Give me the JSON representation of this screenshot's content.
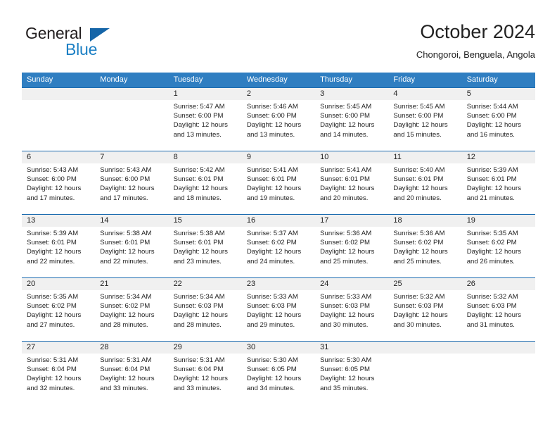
{
  "brand": {
    "name_part1": "General",
    "name_part2": "Blue",
    "triangle_color": "#1565a8",
    "blue_color": "#1b7fc4"
  },
  "header": {
    "title": "October 2024",
    "subtitle": "Chongoroi, Benguela, Angola"
  },
  "colors": {
    "header_row_bg": "#2f7ec1",
    "header_row_text": "#ffffff",
    "week_strip_bg": "#f0f0f0",
    "week_divider": "#1b6bb0",
    "text": "#222222"
  },
  "weekdays": [
    "Sunday",
    "Monday",
    "Tuesday",
    "Wednesday",
    "Thursday",
    "Friday",
    "Saturday"
  ],
  "weeks": [
    {
      "days": [
        {
          "number": "",
          "empty": true,
          "sunrise": "",
          "sunset": "",
          "daylight_line1": "",
          "daylight_line2": ""
        },
        {
          "number": "",
          "empty": true,
          "sunrise": "",
          "sunset": "",
          "daylight_line1": "",
          "daylight_line2": ""
        },
        {
          "number": "1",
          "empty": false,
          "sunrise": "Sunrise: 5:47 AM",
          "sunset": "Sunset: 6:00 PM",
          "daylight_line1": "Daylight: 12 hours",
          "daylight_line2": "and 13 minutes."
        },
        {
          "number": "2",
          "empty": false,
          "sunrise": "Sunrise: 5:46 AM",
          "sunset": "Sunset: 6:00 PM",
          "daylight_line1": "Daylight: 12 hours",
          "daylight_line2": "and 13 minutes."
        },
        {
          "number": "3",
          "empty": false,
          "sunrise": "Sunrise: 5:45 AM",
          "sunset": "Sunset: 6:00 PM",
          "daylight_line1": "Daylight: 12 hours",
          "daylight_line2": "and 14 minutes."
        },
        {
          "number": "4",
          "empty": false,
          "sunrise": "Sunrise: 5:45 AM",
          "sunset": "Sunset: 6:00 PM",
          "daylight_line1": "Daylight: 12 hours",
          "daylight_line2": "and 15 minutes."
        },
        {
          "number": "5",
          "empty": false,
          "sunrise": "Sunrise: 5:44 AM",
          "sunset": "Sunset: 6:00 PM",
          "daylight_line1": "Daylight: 12 hours",
          "daylight_line2": "and 16 minutes."
        }
      ]
    },
    {
      "days": [
        {
          "number": "6",
          "empty": false,
          "sunrise": "Sunrise: 5:43 AM",
          "sunset": "Sunset: 6:00 PM",
          "daylight_line1": "Daylight: 12 hours",
          "daylight_line2": "and 17 minutes."
        },
        {
          "number": "7",
          "empty": false,
          "sunrise": "Sunrise: 5:43 AM",
          "sunset": "Sunset: 6:00 PM",
          "daylight_line1": "Daylight: 12 hours",
          "daylight_line2": "and 17 minutes."
        },
        {
          "number": "8",
          "empty": false,
          "sunrise": "Sunrise: 5:42 AM",
          "sunset": "Sunset: 6:01 PM",
          "daylight_line1": "Daylight: 12 hours",
          "daylight_line2": "and 18 minutes."
        },
        {
          "number": "9",
          "empty": false,
          "sunrise": "Sunrise: 5:41 AM",
          "sunset": "Sunset: 6:01 PM",
          "daylight_line1": "Daylight: 12 hours",
          "daylight_line2": "and 19 minutes."
        },
        {
          "number": "10",
          "empty": false,
          "sunrise": "Sunrise: 5:41 AM",
          "sunset": "Sunset: 6:01 PM",
          "daylight_line1": "Daylight: 12 hours",
          "daylight_line2": "and 20 minutes."
        },
        {
          "number": "11",
          "empty": false,
          "sunrise": "Sunrise: 5:40 AM",
          "sunset": "Sunset: 6:01 PM",
          "daylight_line1": "Daylight: 12 hours",
          "daylight_line2": "and 20 minutes."
        },
        {
          "number": "12",
          "empty": false,
          "sunrise": "Sunrise: 5:39 AM",
          "sunset": "Sunset: 6:01 PM",
          "daylight_line1": "Daylight: 12 hours",
          "daylight_line2": "and 21 minutes."
        }
      ]
    },
    {
      "days": [
        {
          "number": "13",
          "empty": false,
          "sunrise": "Sunrise: 5:39 AM",
          "sunset": "Sunset: 6:01 PM",
          "daylight_line1": "Daylight: 12 hours",
          "daylight_line2": "and 22 minutes."
        },
        {
          "number": "14",
          "empty": false,
          "sunrise": "Sunrise: 5:38 AM",
          "sunset": "Sunset: 6:01 PM",
          "daylight_line1": "Daylight: 12 hours",
          "daylight_line2": "and 22 minutes."
        },
        {
          "number": "15",
          "empty": false,
          "sunrise": "Sunrise: 5:38 AM",
          "sunset": "Sunset: 6:01 PM",
          "daylight_line1": "Daylight: 12 hours",
          "daylight_line2": "and 23 minutes."
        },
        {
          "number": "16",
          "empty": false,
          "sunrise": "Sunrise: 5:37 AM",
          "sunset": "Sunset: 6:02 PM",
          "daylight_line1": "Daylight: 12 hours",
          "daylight_line2": "and 24 minutes."
        },
        {
          "number": "17",
          "empty": false,
          "sunrise": "Sunrise: 5:36 AM",
          "sunset": "Sunset: 6:02 PM",
          "daylight_line1": "Daylight: 12 hours",
          "daylight_line2": "and 25 minutes."
        },
        {
          "number": "18",
          "empty": false,
          "sunrise": "Sunrise: 5:36 AM",
          "sunset": "Sunset: 6:02 PM",
          "daylight_line1": "Daylight: 12 hours",
          "daylight_line2": "and 25 minutes."
        },
        {
          "number": "19",
          "empty": false,
          "sunrise": "Sunrise: 5:35 AM",
          "sunset": "Sunset: 6:02 PM",
          "daylight_line1": "Daylight: 12 hours",
          "daylight_line2": "and 26 minutes."
        }
      ]
    },
    {
      "days": [
        {
          "number": "20",
          "empty": false,
          "sunrise": "Sunrise: 5:35 AM",
          "sunset": "Sunset: 6:02 PM",
          "daylight_line1": "Daylight: 12 hours",
          "daylight_line2": "and 27 minutes."
        },
        {
          "number": "21",
          "empty": false,
          "sunrise": "Sunrise: 5:34 AM",
          "sunset": "Sunset: 6:02 PM",
          "daylight_line1": "Daylight: 12 hours",
          "daylight_line2": "and 28 minutes."
        },
        {
          "number": "22",
          "empty": false,
          "sunrise": "Sunrise: 5:34 AM",
          "sunset": "Sunset: 6:03 PM",
          "daylight_line1": "Daylight: 12 hours",
          "daylight_line2": "and 28 minutes."
        },
        {
          "number": "23",
          "empty": false,
          "sunrise": "Sunrise: 5:33 AM",
          "sunset": "Sunset: 6:03 PM",
          "daylight_line1": "Daylight: 12 hours",
          "daylight_line2": "and 29 minutes."
        },
        {
          "number": "24",
          "empty": false,
          "sunrise": "Sunrise: 5:33 AM",
          "sunset": "Sunset: 6:03 PM",
          "daylight_line1": "Daylight: 12 hours",
          "daylight_line2": "and 30 minutes."
        },
        {
          "number": "25",
          "empty": false,
          "sunrise": "Sunrise: 5:32 AM",
          "sunset": "Sunset: 6:03 PM",
          "daylight_line1": "Daylight: 12 hours",
          "daylight_line2": "and 30 minutes."
        },
        {
          "number": "26",
          "empty": false,
          "sunrise": "Sunrise: 5:32 AM",
          "sunset": "Sunset: 6:03 PM",
          "daylight_line1": "Daylight: 12 hours",
          "daylight_line2": "and 31 minutes."
        }
      ]
    },
    {
      "days": [
        {
          "number": "27",
          "empty": false,
          "sunrise": "Sunrise: 5:31 AM",
          "sunset": "Sunset: 6:04 PM",
          "daylight_line1": "Daylight: 12 hours",
          "daylight_line2": "and 32 minutes."
        },
        {
          "number": "28",
          "empty": false,
          "sunrise": "Sunrise: 5:31 AM",
          "sunset": "Sunset: 6:04 PM",
          "daylight_line1": "Daylight: 12 hours",
          "daylight_line2": "and 33 minutes."
        },
        {
          "number": "29",
          "empty": false,
          "sunrise": "Sunrise: 5:31 AM",
          "sunset": "Sunset: 6:04 PM",
          "daylight_line1": "Daylight: 12 hours",
          "daylight_line2": "and 33 minutes."
        },
        {
          "number": "30",
          "empty": false,
          "sunrise": "Sunrise: 5:30 AM",
          "sunset": "Sunset: 6:05 PM",
          "daylight_line1": "Daylight: 12 hours",
          "daylight_line2": "and 34 minutes."
        },
        {
          "number": "31",
          "empty": false,
          "sunrise": "Sunrise: 5:30 AM",
          "sunset": "Sunset: 6:05 PM",
          "daylight_line1": "Daylight: 12 hours",
          "daylight_line2": "and 35 minutes."
        },
        {
          "number": "",
          "empty": true,
          "sunrise": "",
          "sunset": "",
          "daylight_line1": "",
          "daylight_line2": ""
        },
        {
          "number": "",
          "empty": true,
          "sunrise": "",
          "sunset": "",
          "daylight_line1": "",
          "daylight_line2": ""
        }
      ]
    }
  ]
}
